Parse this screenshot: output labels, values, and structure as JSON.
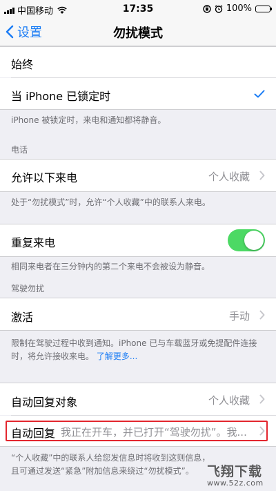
{
  "status_bar": {
    "carrier": "中国移动",
    "time": "17:35",
    "battery": "100%",
    "battery_level": 1.0
  },
  "nav": {
    "back_label": "设置",
    "title": "勿扰模式"
  },
  "silence": {
    "always_label": "始终",
    "locked_label": "当 iPhone 已锁定时",
    "selected": "locked",
    "note": "iPhone 被锁定时，来电和通知都将静音。"
  },
  "phone": {
    "header": "电话",
    "allow_calls_label": "允许以下来电",
    "allow_calls_value": "个人收藏",
    "allow_calls_note": "处于“勿扰模式”时，允许“个人收藏”中的联系人来电。",
    "repeated_calls_label": "重复来电",
    "repeated_calls_on": true,
    "repeated_calls_note": "相同来电者在三分钟内的第二个来电不会被设为静音。"
  },
  "driving": {
    "header": "驾驶勿扰",
    "activate_label": "激活",
    "activate_value": "手动",
    "note": "限制在驾驶过程中收到通知。iPhone 已与车载蓝牙或免提配件连接时，将允许接收来电。",
    "learn_more": "了解更多...",
    "auto_reply_to_label": "自动回复对象",
    "auto_reply_to_value": "个人收藏",
    "auto_reply_label": "自动回复",
    "auto_reply_value": "我正在开车，并已打开“驾驶勿扰”。我...",
    "footer_note": "“个人收藏”中的联系人给您发信息时将收到这则信息，且可通过发送“紧急”附加信息来绕过“勿扰模式”。"
  },
  "watermark": {
    "logo": "飞翔下载",
    "url": "www.52z.com"
  },
  "colors": {
    "accent": "#1a7cf5",
    "toggle_on": "#4cd964",
    "highlight": "#e3262e"
  }
}
